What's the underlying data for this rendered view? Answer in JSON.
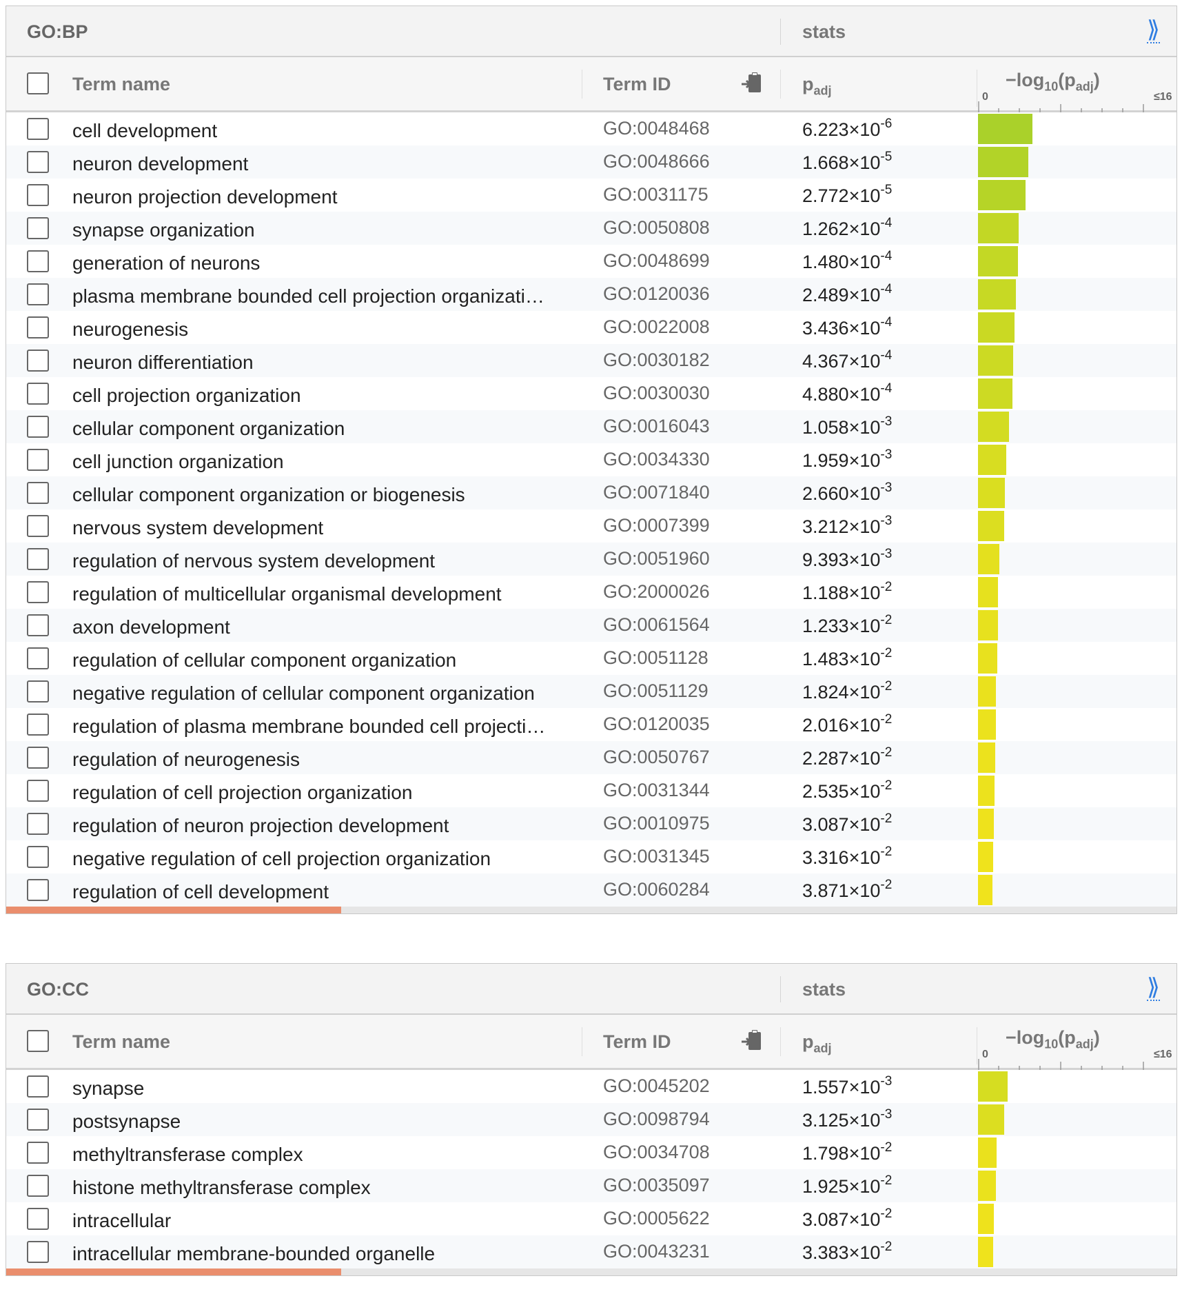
{
  "panels": [
    {
      "source": "GO:BP",
      "stats_label": "stats",
      "expand_icon": "double-chevron-right-icon",
      "columns": {
        "term_name": "Term name",
        "term_id": "Term ID",
        "p_main": "p",
        "p_sub": "adj",
        "log_prefix": "−log",
        "log_base": "10",
        "log_open": "(p",
        "log_sub": "adj",
        "log_close": ")",
        "axis_min": "0",
        "axis_max": "≤16"
      },
      "rows": [
        {
          "name": "cell development",
          "id": "GO:0048468",
          "p_mant": "6.223×10",
          "p_exp": "-6",
          "neglog10": 5.206
        },
        {
          "name": "neuron development",
          "id": "GO:0048666",
          "p_mant": "1.668×10",
          "p_exp": "-5",
          "neglog10": 4.778
        },
        {
          "name": "neuron projection development",
          "id": "GO:0031175",
          "p_mant": "2.772×10",
          "p_exp": "-5",
          "neglog10": 4.557
        },
        {
          "name": "synapse organization",
          "id": "GO:0050808",
          "p_mant": "1.262×10",
          "p_exp": "-4",
          "neglog10": 3.899
        },
        {
          "name": "generation of neurons",
          "id": "GO:0048699",
          "p_mant": "1.480×10",
          "p_exp": "-4",
          "neglog10": 3.83
        },
        {
          "name": "plasma membrane bounded cell projection organizati…",
          "id": "GO:0120036",
          "p_mant": "2.489×10",
          "p_exp": "-4",
          "neglog10": 3.604
        },
        {
          "name": "neurogenesis",
          "id": "GO:0022008",
          "p_mant": "3.436×10",
          "p_exp": "-4",
          "neglog10": 3.464
        },
        {
          "name": "neuron differentiation",
          "id": "GO:0030182",
          "p_mant": "4.367×10",
          "p_exp": "-4",
          "neglog10": 3.36
        },
        {
          "name": "cell projection organization",
          "id": "GO:0030030",
          "p_mant": "4.880×10",
          "p_exp": "-4",
          "neglog10": 3.312
        },
        {
          "name": "cellular component organization",
          "id": "GO:0016043",
          "p_mant": "1.058×10",
          "p_exp": "-3",
          "neglog10": 2.976
        },
        {
          "name": "cell junction organization",
          "id": "GO:0034330",
          "p_mant": "1.959×10",
          "p_exp": "-3",
          "neglog10": 2.708
        },
        {
          "name": "cellular component organization or biogenesis",
          "id": "GO:0071840",
          "p_mant": "2.660×10",
          "p_exp": "-3",
          "neglog10": 2.575
        },
        {
          "name": "nervous system development",
          "id": "GO:0007399",
          "p_mant": "3.212×10",
          "p_exp": "-3",
          "neglog10": 2.493
        },
        {
          "name": "regulation of nervous system development",
          "id": "GO:0051960",
          "p_mant": "9.393×10",
          "p_exp": "-3",
          "neglog10": 2.027
        },
        {
          "name": "regulation of multicellular organismal development",
          "id": "GO:2000026",
          "p_mant": "1.188×10",
          "p_exp": "-2",
          "neglog10": 1.925
        },
        {
          "name": "axon development",
          "id": "GO:0061564",
          "p_mant": "1.233×10",
          "p_exp": "-2",
          "neglog10": 1.909
        },
        {
          "name": "regulation of cellular component organization",
          "id": "GO:0051128",
          "p_mant": "1.483×10",
          "p_exp": "-2",
          "neglog10": 1.829
        },
        {
          "name": "negative regulation of cellular component organization",
          "id": "GO:0051129",
          "p_mant": "1.824×10",
          "p_exp": "-2",
          "neglog10": 1.739
        },
        {
          "name": "regulation of plasma membrane bounded cell projecti…",
          "id": "GO:0120035",
          "p_mant": "2.016×10",
          "p_exp": "-2",
          "neglog10": 1.696
        },
        {
          "name": "regulation of neurogenesis",
          "id": "GO:0050767",
          "p_mant": "2.287×10",
          "p_exp": "-2",
          "neglog10": 1.641
        },
        {
          "name": "regulation of cell projection organization",
          "id": "GO:0031344",
          "p_mant": "2.535×10",
          "p_exp": "-2",
          "neglog10": 1.596
        },
        {
          "name": "regulation of neuron projection development",
          "id": "GO:0010975",
          "p_mant": "3.087×10",
          "p_exp": "-2",
          "neglog10": 1.51
        },
        {
          "name": "negative regulation of cell projection organization",
          "id": "GO:0031345",
          "p_mant": "3.316×10",
          "p_exp": "-2",
          "neglog10": 1.479
        },
        {
          "name": "regulation of cell development",
          "id": "GO:0060284",
          "p_mant": "3.871×10",
          "p_exp": "-2",
          "neglog10": 1.412
        }
      ]
    },
    {
      "source": "GO:CC",
      "stats_label": "stats",
      "expand_icon": "double-chevron-right-icon",
      "columns": {
        "term_name": "Term name",
        "term_id": "Term ID",
        "p_main": "p",
        "p_sub": "adj",
        "log_prefix": "−log",
        "log_base": "10",
        "log_open": "(p",
        "log_sub": "adj",
        "log_close": ")",
        "axis_min": "0",
        "axis_max": "≤16"
      },
      "rows": [
        {
          "name": "synapse",
          "id": "GO:0045202",
          "p_mant": "1.557×10",
          "p_exp": "-3",
          "neglog10": 2.808
        },
        {
          "name": "postsynapse",
          "id": "GO:0098794",
          "p_mant": "3.125×10",
          "p_exp": "-3",
          "neglog10": 2.505
        },
        {
          "name": "methyltransferase complex",
          "id": "GO:0034708",
          "p_mant": "1.798×10",
          "p_exp": "-2",
          "neglog10": 1.745
        },
        {
          "name": "histone methyltransferase complex",
          "id": "GO:0035097",
          "p_mant": "1.925×10",
          "p_exp": "-2",
          "neglog10": 1.716
        },
        {
          "name": "intracellular",
          "id": "GO:0005622",
          "p_mant": "3.087×10",
          "p_exp": "-2",
          "neglog10": 1.51
        },
        {
          "name": "intracellular membrane-bounded organelle",
          "id": "GO:0043231",
          "p_mant": "3.383×10",
          "p_exp": "-2",
          "neglog10": 1.471
        }
      ]
    }
  ],
  "bar_color_high": "#a8d12a",
  "bar_color_low": "#f0e31c",
  "scale_max": 16
}
